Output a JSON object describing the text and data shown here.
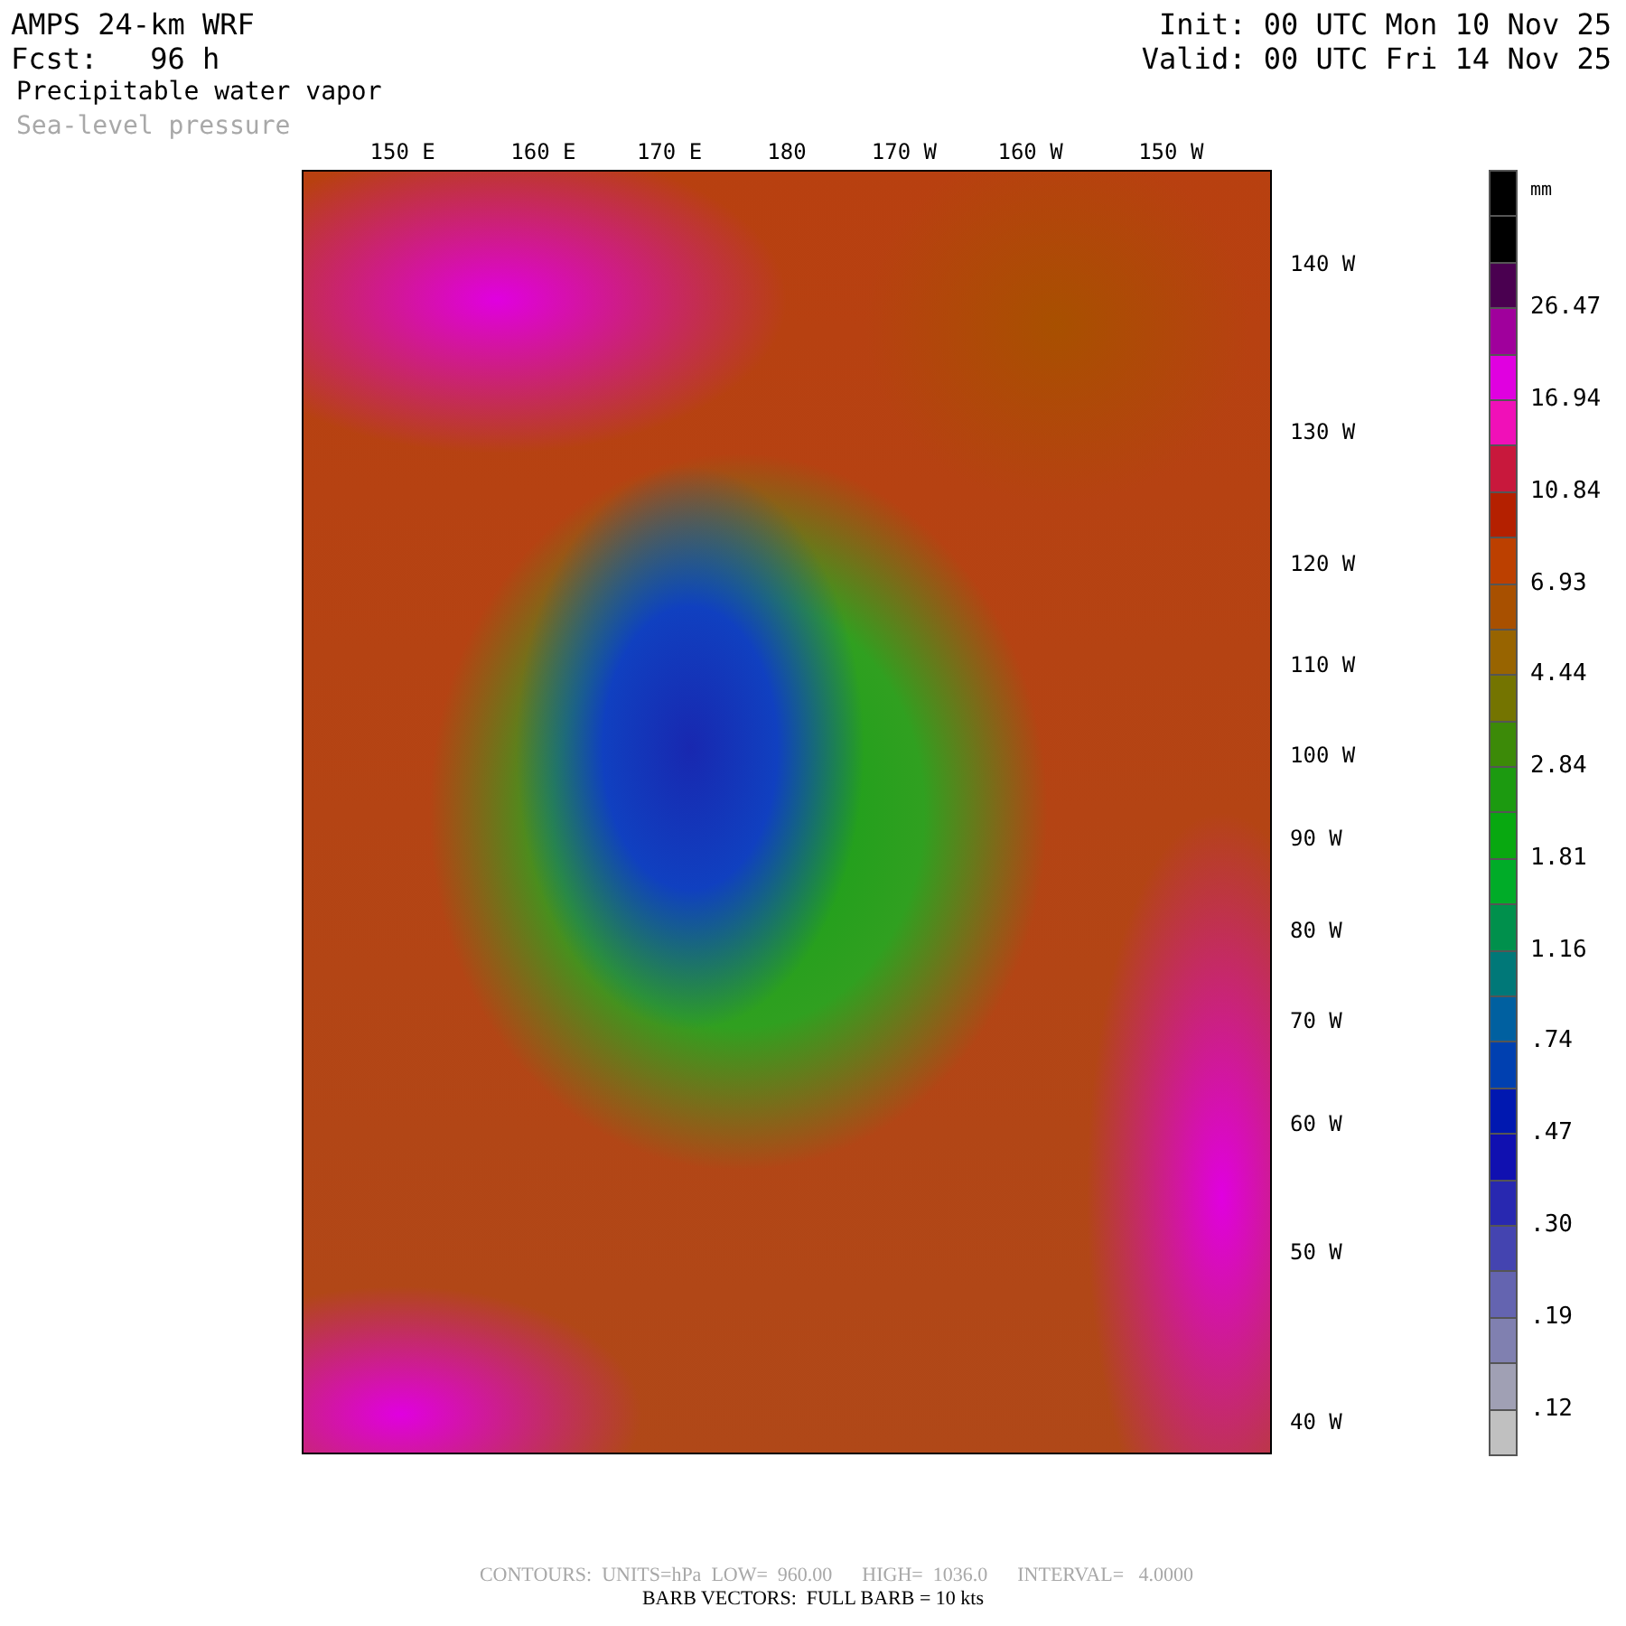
{
  "header": {
    "model": "AMPS 24-km WRF",
    "forecast": "Fcst:   96 h",
    "init": "Init: 00 UTC Mon 10 Nov 25",
    "valid": "Valid: 00 UTC Fri 14 Nov 25",
    "field": "Precipitable water vapor",
    "overlay": "Sea-level pressure"
  },
  "map": {
    "top_labels": [
      "150 E",
      "160 E",
      "170 E",
      "180",
      "170 W",
      "160 W",
      "150 W"
    ],
    "right_labels": [
      "140 W",
      "130 W",
      "120 W",
      "110 W",
      "100 W",
      "90 W",
      "80 W",
      "70 W",
      "60 W",
      "50 W",
      "40 W"
    ]
  },
  "colorbar": {
    "units": "mm",
    "cells": [
      {
        "color": "#000000"
      },
      {
        "color": "#000000"
      },
      {
        "color": "#4a0050"
      },
      {
        "color": "#a0009c",
        "label": "26.47"
      },
      {
        "color": "#e000e0"
      },
      {
        "color": "#f010b8",
        "label": "16.94"
      },
      {
        "color": "#c8183c"
      },
      {
        "color": "#b42000",
        "label": "10.84"
      },
      {
        "color": "#bc4000"
      },
      {
        "color": "#a85000",
        "label": "6.93"
      },
      {
        "color": "#986400"
      },
      {
        "color": "#747400",
        "label": "4.44"
      },
      {
        "color": "#3c8a08"
      },
      {
        "color": "#1c9a10",
        "label": "2.84"
      },
      {
        "color": "#08a810"
      },
      {
        "color": "#00ac28",
        "label": "1.81"
      },
      {
        "color": "#00904c"
      },
      {
        "color": "#007878",
        "label": "1.16"
      },
      {
        "color": "#0060a0"
      },
      {
        "color": "#0040b0",
        "label": ".74"
      },
      {
        "color": "#0018b0"
      },
      {
        "color": "#1010b0",
        "label": ".47"
      },
      {
        "color": "#2828b0"
      },
      {
        "color": "#4444b0",
        "label": ".30"
      },
      {
        "color": "#6464b0"
      },
      {
        "color": "#8080b0",
        "label": ".19"
      },
      {
        "color": "#a0a0b4"
      },
      {
        "color": "#c0c0c0",
        "label": ".12"
      }
    ]
  },
  "footer": {
    "contours": "CONTOURS:  UNITS=hPa  LOW=  960.00      HIGH=  1036.0      INTERVAL=   4.0000",
    "barbs": "BARB VECTORS:  FULL BARB = 10 kts"
  }
}
